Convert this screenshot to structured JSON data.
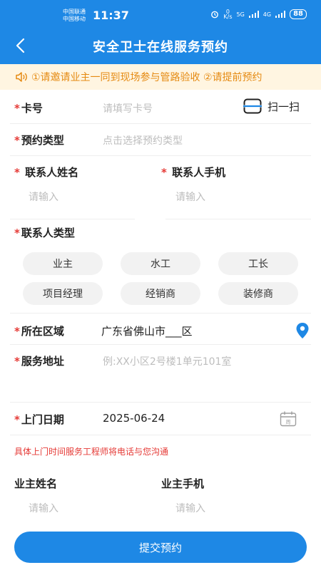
{
  "status_bar": {
    "carrier_1": "中国联通",
    "carrier_2": "中国移动",
    "time": "11:37",
    "speed_value": "0",
    "speed_unit": "K/s",
    "network_5g": "5G",
    "network_4g": "4G",
    "battery": "88"
  },
  "header": {
    "title": "安全卫士在线服务预约"
  },
  "notice": {
    "text": "①请邀请业主一同到现场参与管路验收 ②请提前预约"
  },
  "form": {
    "card": {
      "label": "卡号",
      "placeholder": "请填写卡号",
      "scan_label": "扫一扫"
    },
    "booking_type": {
      "label": "预约类型",
      "placeholder": "点击选择预约类型"
    },
    "contact_name": {
      "label": "联系人姓名",
      "placeholder": "请输入"
    },
    "contact_phone": {
      "label": "联系人手机",
      "placeholder": "请输入"
    },
    "contact_type": {
      "label": "联系人类型",
      "options": [
        "业主",
        "水工",
        "工长",
        "项目经理",
        "经销商",
        "装修商"
      ]
    },
    "area": {
      "label": "所在区域",
      "value": "广东省佛山市___区"
    },
    "address": {
      "label": "服务地址",
      "placeholder": "例:XX小区2号楼1单元101室"
    },
    "visit_date": {
      "label": "上门日期",
      "value": "2025-06-24",
      "calendar_glyph": "周"
    },
    "visit_tip": "具体上门时间服务工程师将电话与您沟通",
    "owner_name": {
      "label": "业主姓名",
      "placeholder": "请输入"
    },
    "owner_phone": {
      "label": "业主手机",
      "placeholder": "请输入"
    },
    "required_mark": "*"
  },
  "submit": {
    "label": "提交预约"
  },
  "colors": {
    "primary": "#1e88e5",
    "notice_bg": "#fff5e1",
    "notice_text": "#e58a12",
    "required": "#e53935"
  }
}
